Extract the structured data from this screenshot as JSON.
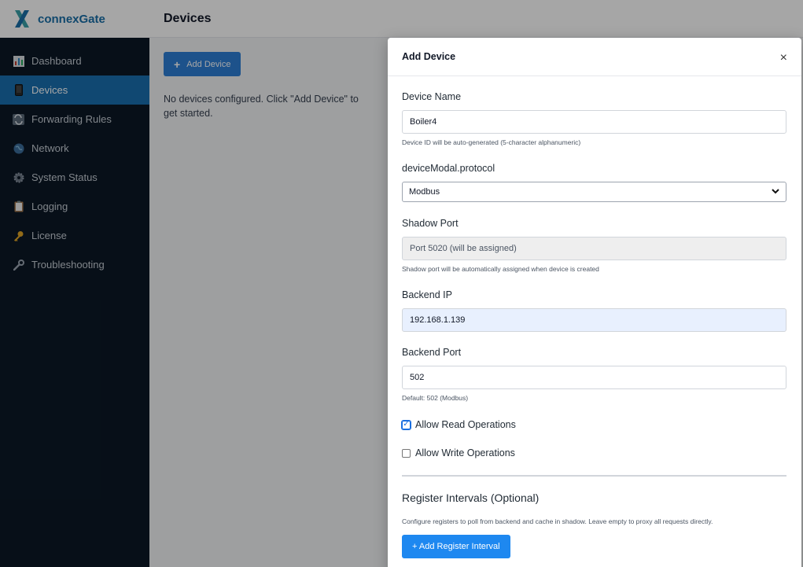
{
  "app": {
    "brand_name": "connexGate"
  },
  "sidebar": {
    "items": [
      {
        "label": "Dashboard",
        "icon": "bar-chart-icon"
      },
      {
        "label": "Devices",
        "icon": "phone-icon"
      },
      {
        "label": "Forwarding Rules",
        "icon": "cycle-arrows-icon"
      },
      {
        "label": "Network",
        "icon": "globe-icon"
      },
      {
        "label": "System Status",
        "icon": "gear-icon"
      },
      {
        "label": "Logging",
        "icon": "clipboard-icon"
      },
      {
        "label": "License",
        "icon": "key-icon"
      },
      {
        "label": "Troubleshooting",
        "icon": "wrench-icon"
      }
    ],
    "active_item": "Devices"
  },
  "header": {
    "title": "Devices"
  },
  "main": {
    "add_device_label": "Add Device",
    "empty_text": "No devices configured. Click \"Add Device\" to get started."
  },
  "modal": {
    "title": "Add Device",
    "close_glyph": "×",
    "device_name": {
      "label": "Device Name",
      "value": "Boiler4",
      "help": "Device ID will be auto-generated (5-character alphanumeric)"
    },
    "protocol": {
      "label": "deviceModal.protocol",
      "selected": "Modbus"
    },
    "shadow_port": {
      "label": "Shadow Port",
      "value": "Port 5020 (will be assigned)",
      "help": "Shadow port will be automatically assigned when device is created"
    },
    "backend_ip": {
      "label": "Backend IP",
      "value": "192.168.1.139"
    },
    "backend_port": {
      "label": "Backend Port",
      "value": "502",
      "help": "Default: 502 (Modbus)"
    },
    "allow_read": {
      "label": "Allow Read Operations",
      "checked": true
    },
    "allow_write": {
      "label": "Allow Write Operations",
      "checked": false
    },
    "register_intervals": {
      "title": "Register Intervals (Optional)",
      "help": "Configure registers to poll from backend and cache in shadow. Leave empty to proxy all requests directly.",
      "add_label": "+ Add Register Interval"
    }
  },
  "colors": {
    "sidebar_bg": "#0b1826",
    "active_nav": "#1a6fb0",
    "primary_button": "#2d7ed6",
    "brand_text": "#1a6fa8"
  }
}
